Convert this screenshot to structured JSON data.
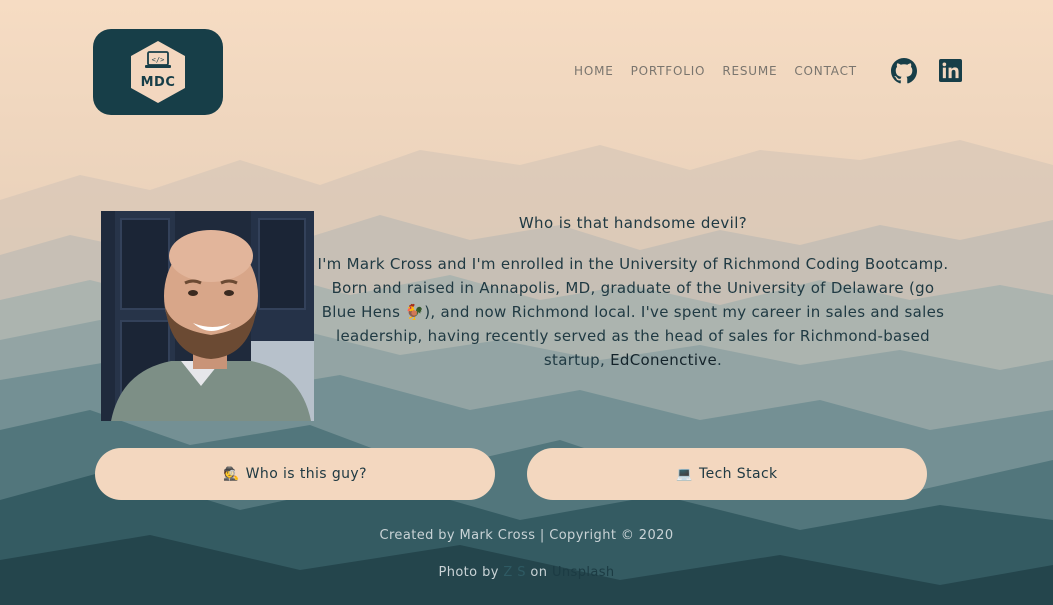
{
  "logo": {
    "text": "MDC"
  },
  "nav": {
    "items": [
      {
        "label": "HOME"
      },
      {
        "label": "PORTFOLIO"
      },
      {
        "label": "RESUME"
      },
      {
        "label": "CONTACT"
      }
    ],
    "icons": [
      "github-icon",
      "linkedin-icon"
    ]
  },
  "about": {
    "heading": "Who is that handsome devil?",
    "para_before": "I'm Mark Cross and I'm enrolled in the University of Richmond Coding Bootcamp. Born and raised in Annapolis, MD, graduate of the University of Delaware (go Blue Hens ",
    "emoji": "🐓",
    "para_middle": "), and now Richmond local. I've spent my career in sales and sales leadership, having recently served as the head of sales for Richmond-based startup, ",
    "link": "EdConenctive",
    "para_after": "."
  },
  "buttons": {
    "who": {
      "icon": "🕵",
      "label": "Who is this guy?"
    },
    "tech": {
      "icon": "💻",
      "label": "Tech Stack"
    }
  },
  "footer": {
    "created": "Created by Mark Cross | Copyright © 2020",
    "photo_by": "Photo by",
    "photographer": "Z S",
    "on": "on",
    "site": "Unsplash"
  },
  "colors": {
    "accent_dark": "#173e48",
    "button_bg": "#f3d7bf",
    "text_dark": "#203a43"
  }
}
